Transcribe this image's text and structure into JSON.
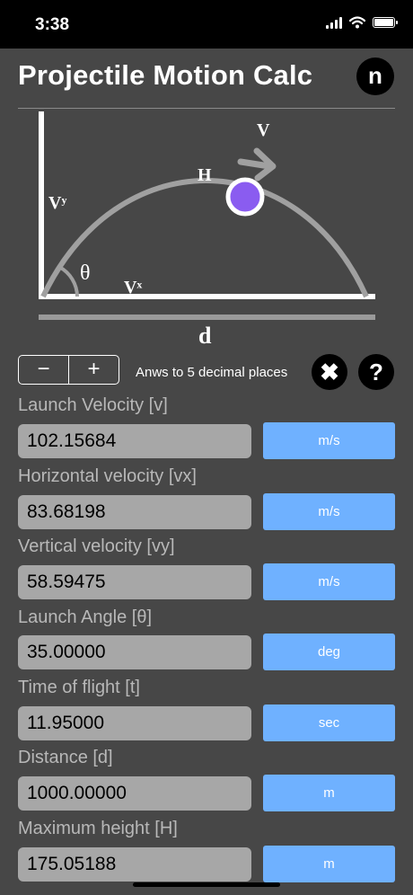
{
  "status": {
    "time": "3:38"
  },
  "header": {
    "title": "Projectile Motion Calc",
    "logo_letter": "n"
  },
  "diagram": {
    "label_v": "V",
    "label_h": "H",
    "label_vy": "Vʸ",
    "label_theta": "θ",
    "label_vx": "Vˣ",
    "label_d": "d"
  },
  "controls": {
    "minus": "−",
    "plus": "+",
    "decimals_text": "Anws to 5 decimal places",
    "clear_symbol": "✖",
    "help_symbol": "?"
  },
  "fields": [
    {
      "label": "Launch Velocity [v]",
      "value": "102.15684",
      "unit": "m/s"
    },
    {
      "label": "Horizontal velocity [vx]",
      "value": "83.68198",
      "unit": "m/s"
    },
    {
      "label": "Vertical velocity [vy]",
      "value": "58.59475",
      "unit": "m/s"
    },
    {
      "label": "Launch Angle [θ]",
      "value": "35.00000",
      "unit": "deg"
    },
    {
      "label": "Time of flight [t]",
      "value": "11.95000",
      "unit": "sec"
    },
    {
      "label": "Distance [d]",
      "value": "1000.00000",
      "unit": "m"
    },
    {
      "label": "Maximum height [H]",
      "value": "175.05188",
      "unit": "m"
    }
  ],
  "colors": {
    "background": "#474747",
    "unit_button": "#6fb1ff",
    "input": "#a7a7a7",
    "ball": "#8a5cf0"
  }
}
